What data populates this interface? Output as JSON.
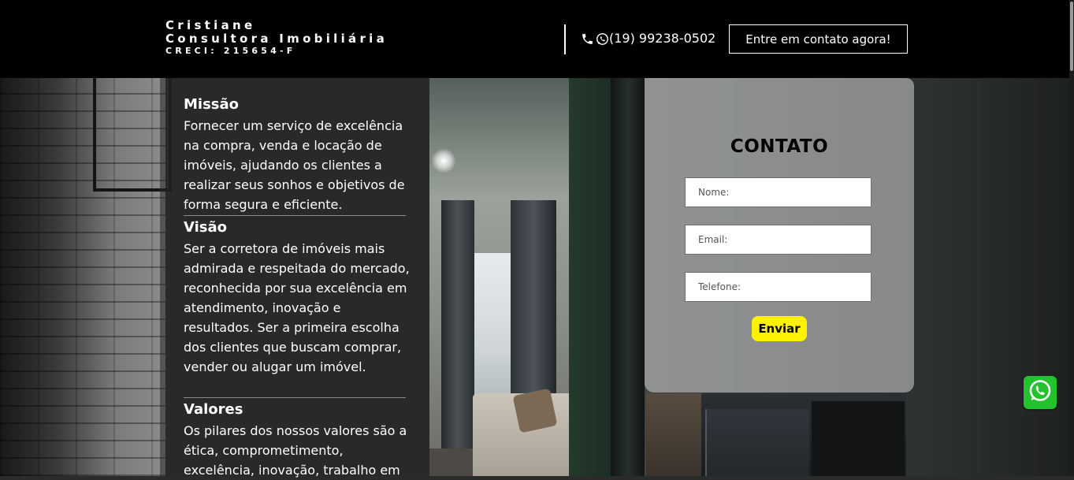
{
  "header": {
    "brand_name": "Cristiane",
    "brand_title": "Consultora Imobiliária",
    "brand_creci": "CRECI: 215654-F",
    "phone": "(19) 99238-0502",
    "contact_button_label": "Entre em contato agora!"
  },
  "sections": [
    {
      "title": "Missão",
      "body": "Fornecer um serviço de excelência na compra, venda e locação de imóveis, ajudando os clientes a realizar seus sonhos e objetivos de forma segura e eficiente."
    },
    {
      "title": "Visão",
      "body": "Ser a corretora de imóveis mais admirada e respeitada do mercado, reconhecida por sua excelência em atendimento, inovação e resultados. Ser a primeira escolha dos clientes que buscam comprar, vender ou alugar um imóvel."
    },
    {
      "title": "Valores",
      "body": "Os pilares dos nossos valores são a ética, comprometimento, excelência, inovação, trabalho em"
    }
  ],
  "contact_form": {
    "title": "CONTATO",
    "name_placeholder": "Nome:",
    "email_placeholder": "Email:",
    "phone_placeholder": "Telefone:",
    "submit_label": "Enviar"
  },
  "icons": {
    "phone": "phone-icon",
    "whatsapp": "whatsapp-icon"
  },
  "colors": {
    "header_bg": "#000000",
    "submit_bg": "#fff200",
    "whatsapp_green": "#25c22f"
  }
}
